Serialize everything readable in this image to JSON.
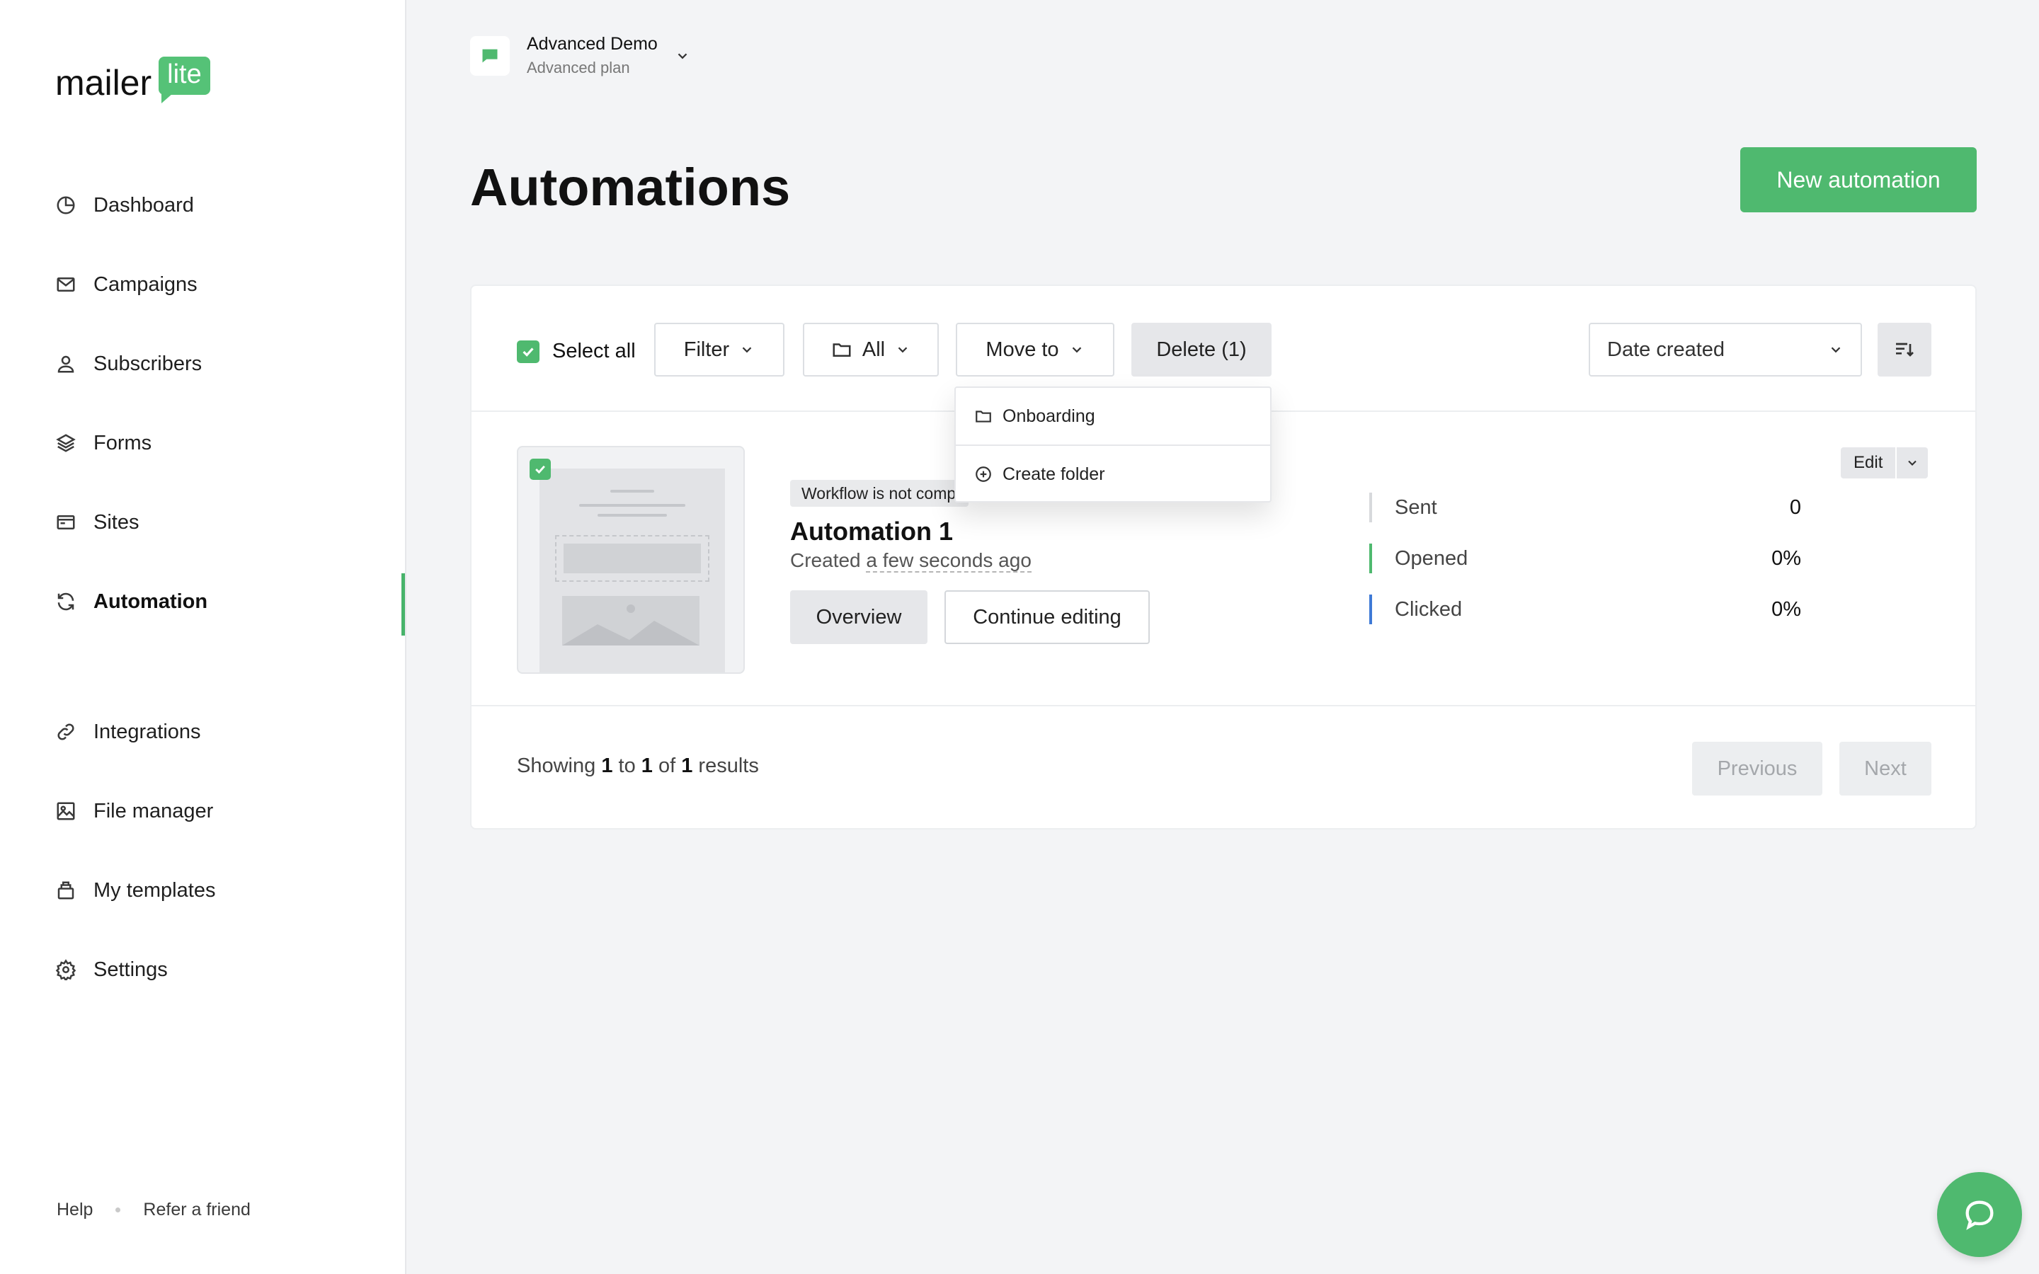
{
  "brand": {
    "word": "mailer",
    "tag": "lite",
    "accent": "#4fb96f"
  },
  "sidebar": {
    "items": [
      {
        "label": "Dashboard",
        "icon": "dashboard-icon"
      },
      {
        "label": "Campaigns",
        "icon": "mail-icon"
      },
      {
        "label": "Subscribers",
        "icon": "user-icon"
      },
      {
        "label": "Forms",
        "icon": "layers-icon"
      },
      {
        "label": "Sites",
        "icon": "browser-icon"
      },
      {
        "label": "Automation",
        "icon": "refresh-icon",
        "active": true
      },
      {
        "label": "Integrations",
        "icon": "link-icon"
      },
      {
        "label": "File manager",
        "icon": "image-icon"
      },
      {
        "label": "My templates",
        "icon": "template-icon"
      },
      {
        "label": "Settings",
        "icon": "gear-icon"
      }
    ],
    "footer": {
      "help": "Help",
      "refer": "Refer a friend"
    }
  },
  "account": {
    "name": "Advanced Demo",
    "plan": "Advanced plan"
  },
  "page": {
    "title": "Automations",
    "new_button": "New automation"
  },
  "toolbar": {
    "select_all": "Select all",
    "filter": "Filter",
    "folder": "All",
    "move_to": "Move to",
    "delete": "Delete (1)",
    "sort": "Date created"
  },
  "move_menu": {
    "items": [
      "Onboarding",
      "Create folder"
    ]
  },
  "automation": {
    "badge": "Workflow is not complete",
    "name": "Automation 1",
    "created_prefix": "Created",
    "created_time": "a few seconds ago",
    "overview": "Overview",
    "continue": "Continue editing",
    "edit": "Edit",
    "stats": [
      {
        "name": "Sent",
        "value": "0",
        "color": "#d7d9dc"
      },
      {
        "name": "Opened",
        "value": "0%",
        "color": "#4fb96f"
      },
      {
        "name": "Clicked",
        "value": "0%",
        "color": "#3f7ad6"
      }
    ]
  },
  "pagination": {
    "showing": "Showing",
    "from": "1",
    "to_word": "to",
    "to": "1",
    "of_word": "of",
    "total": "1",
    "results": "results",
    "previous": "Previous",
    "next": "Next"
  }
}
